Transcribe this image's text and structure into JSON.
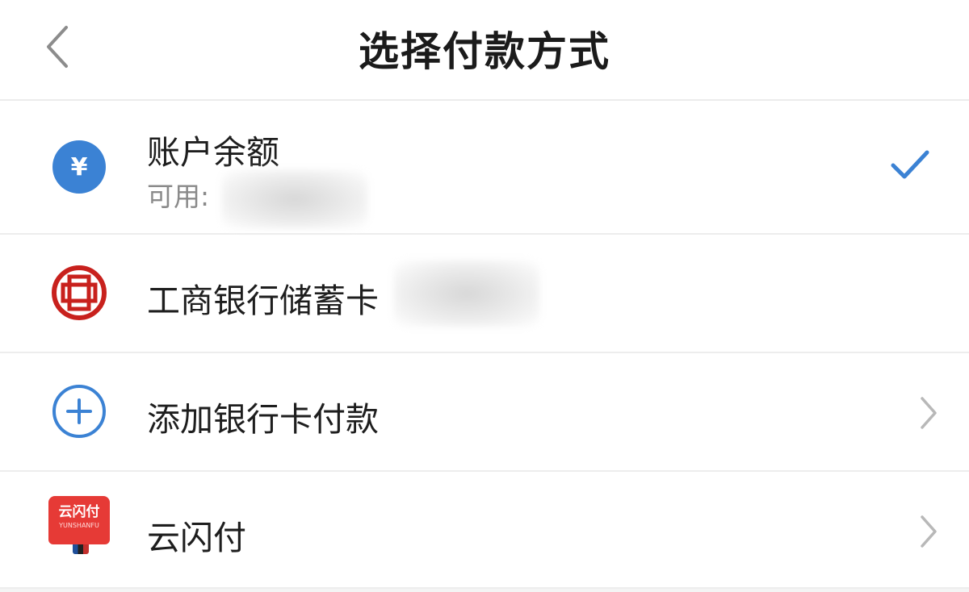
{
  "header": {
    "title": "选择付款方式"
  },
  "methods": [
    {
      "label": "账户余额",
      "sub_label": "可用:",
      "icon": "yuan-circle-icon",
      "selected": true
    },
    {
      "label": "工商银行储蓄卡",
      "icon": "icbc-logo-icon",
      "selected": false
    },
    {
      "label": "添加银行卡付款",
      "icon": "plus-circle-icon",
      "selected": false
    },
    {
      "label": "云闪付",
      "icon": "unionpay-quickpass-logo-icon",
      "logo_text": "云闪付",
      "logo_subtext": "YUNSHANFU",
      "selected": false
    }
  ],
  "colors": {
    "accent_blue": "#3b82d4",
    "icbc_red": "#c8211d",
    "ysf_red": "#e63a36",
    "text_primary": "#1e1e1e",
    "text_secondary": "#8a8a8a"
  }
}
